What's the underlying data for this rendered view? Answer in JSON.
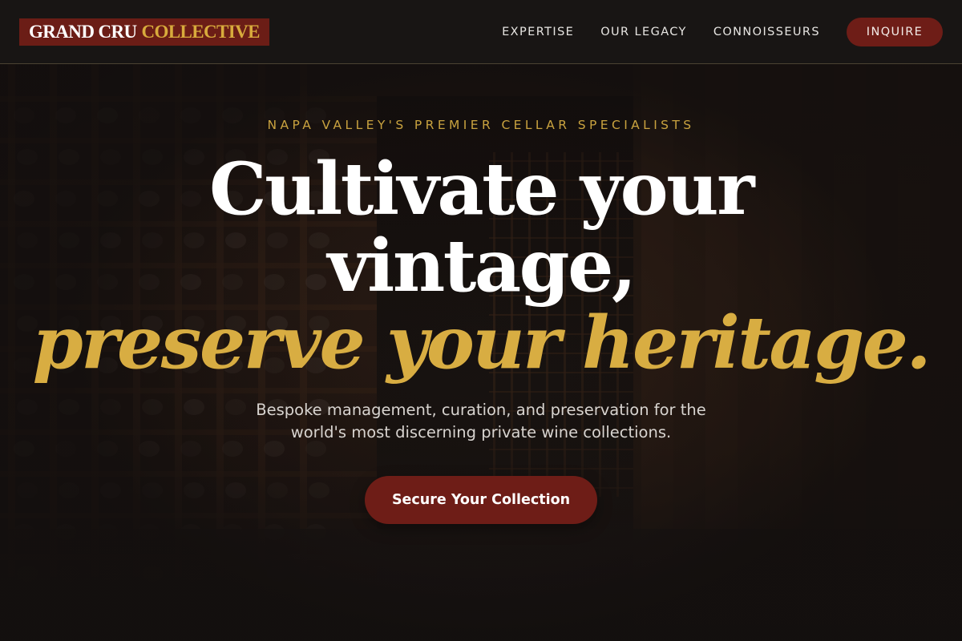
{
  "brand": {
    "name_primary": "GRAND CRU",
    "name_accent": "COLLECTIVE",
    "logo_bg": "#6b1d16",
    "accent": "#d8ab3c"
  },
  "nav": {
    "links": [
      "EXPERTISE",
      "OUR LEGACY",
      "CONNOISSEURS"
    ],
    "cta_label": "INQUIRE"
  },
  "hero": {
    "eyebrow": "NAPA VALLEY'S PREMIER CELLAR SPECIALISTS",
    "headline_line1": "Cultivate your",
    "headline_line2": "vintage,",
    "headline_accent": "preserve your heritage.",
    "subtext": "Bespoke management, curation, and preservation for the world's most discerning private wine collections.",
    "cta_label": "Secure Your Collection",
    "background_image": "wine cellar racks"
  },
  "colors": {
    "burgundy": "#6e1d17",
    "gold": "#d8ad42",
    "dark": "#1a1716"
  }
}
